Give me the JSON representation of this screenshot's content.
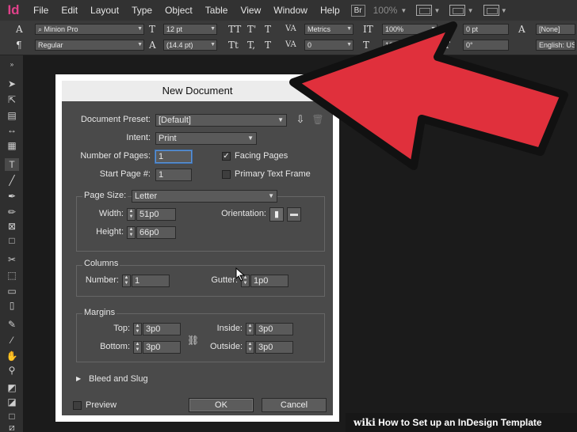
{
  "menubar": {
    "logo": "Id",
    "items": [
      "File",
      "Edit",
      "Layout",
      "Type",
      "Object",
      "Table",
      "View",
      "Window",
      "Help"
    ],
    "badge": "Br",
    "zoom": "100%"
  },
  "controlbar": {
    "font_family": "Minion Pro",
    "font_style": "Regular",
    "font_size": "12 pt",
    "leading": "(14.4 pt)",
    "kerning": "Metrics",
    "tracking": "0",
    "h_scale": "100%",
    "v_scale": "100%",
    "baseline": "0 pt",
    "skew": "0°",
    "char_style": "[None]",
    "language": "English: USA"
  },
  "dialog": {
    "title": "New Document",
    "document_preset_label": "Document Preset:",
    "document_preset_value": "[Default]",
    "intent_label": "Intent:",
    "intent_value": "Print",
    "number_of_pages_label": "Number of Pages:",
    "number_of_pages_value": "1",
    "start_page_label": "Start Page #:",
    "start_page_value": "1",
    "facing_pages_label": "Facing Pages",
    "facing_pages_checked": true,
    "primary_text_frame_label": "Primary Text Frame",
    "primary_text_frame_checked": false,
    "page_size_label": "Page Size:",
    "page_size_value": "Letter",
    "width_label": "Width:",
    "width_value": "51p0",
    "height_label": "Height:",
    "height_value": "66p0",
    "orientation_label": "Orientation:",
    "columns_title": "Columns",
    "columns_number_label": "Number:",
    "columns_number_value": "1",
    "gutter_label": "Gutter:",
    "gutter_value": "1p0",
    "margins_title": "Margins",
    "top_label": "Top:",
    "top_value": "3p0",
    "bottom_label": "Bottom:",
    "bottom_value": "3p0",
    "inside_label": "Inside:",
    "inside_value": "3p0",
    "outside_label": "Outside:",
    "outside_value": "3p0",
    "bleed_slug_label": "Bleed and Slug",
    "preview_label": "Preview",
    "ok_label": "OK",
    "cancel_label": "Cancel"
  },
  "watermark": {
    "brand": "wiki",
    "text": "How to Set up an InDesign Template"
  },
  "colors": {
    "arrow_fill": "#e0303c",
    "arrow_outline": "#111111",
    "logo": "#e0418a",
    "dialog_bg": "#4a4a4a",
    "focus": "#5b93d6"
  }
}
